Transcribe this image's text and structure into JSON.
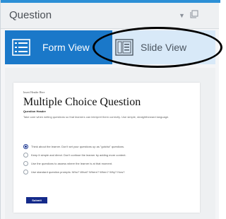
{
  "panel": {
    "title": "Question"
  },
  "tabs": [
    {
      "label": "Form View",
      "selected": true
    },
    {
      "label": "Slide View",
      "selected": false
    }
  ],
  "slide": {
    "small_header": "Insert Header Here",
    "title": "Multiple Choice Question",
    "question_header": "Question Header",
    "description": "Take care when writing questions so that learners can interpret them correctly. Use simple, straightforward language.",
    "options": [
      {
        "text": "Think about the learner. Don't set your questions up as \"gotcha\" questions.",
        "selected": true
      },
      {
        "text": "Keep it simple and direct. Don't confuse the learner by adding more content.",
        "selected": false
      },
      {
        "text": "Use the questions to assess where the learner is at that moment.",
        "selected": false
      },
      {
        "text": "Use standard question prompts: Who? What? Where? When? Why? How?",
        "selected": false
      }
    ],
    "submit_label": "Submit"
  },
  "colors": {
    "accent": "#1a78c9",
    "tab_inactive": "#d8e9f8",
    "submit": "#142a8a"
  }
}
